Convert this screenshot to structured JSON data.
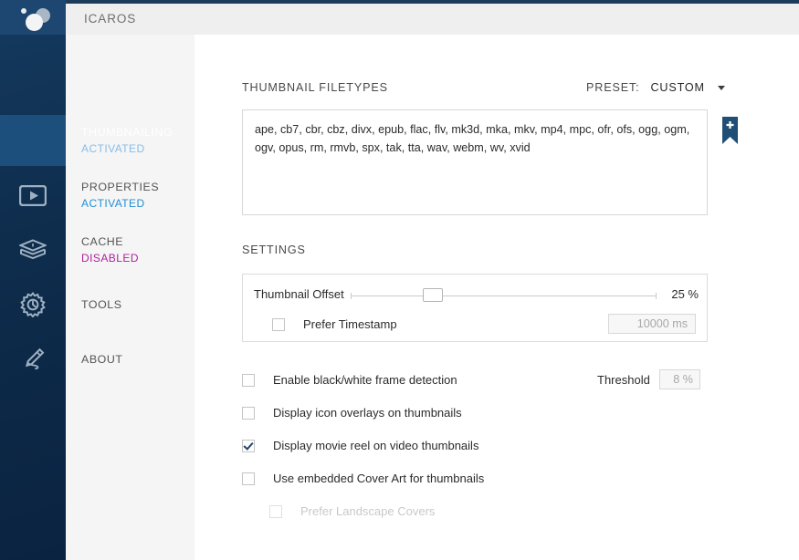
{
  "window": {
    "title": "ICAROS",
    "accent_navy": "#1d3c5c",
    "accent_selected": "#1c4f7c",
    "accent_activated": "#1f8fd6",
    "accent_disabled": "#b0219b"
  },
  "rail": {
    "logo_name": "icaros-logo",
    "icons": [
      {
        "name": "image-icon",
        "for": "thumbnailing"
      },
      {
        "name": "video-play-icon",
        "for": "properties"
      },
      {
        "name": "database-stack-icon",
        "for": "cache"
      },
      {
        "name": "gear-clock-icon",
        "for": "tools"
      },
      {
        "name": "pen-signature-icon",
        "for": "about"
      }
    ]
  },
  "nav": {
    "items": [
      {
        "label": "THUMBNAILING",
        "status": "ACTIVATED",
        "status_kind": "activated",
        "selected": true
      },
      {
        "label": "PROPERTIES",
        "status": "ACTIVATED",
        "status_kind": "activated",
        "selected": false
      },
      {
        "label": "CACHE",
        "status": "DISABLED",
        "status_kind": "disabled",
        "selected": false
      },
      {
        "label": "TOOLS",
        "status": "",
        "status_kind": "none",
        "selected": false
      },
      {
        "label": "ABOUT",
        "status": "",
        "status_kind": "none",
        "selected": false
      }
    ]
  },
  "main": {
    "filetypes_heading": "THUMBNAIL FILETYPES",
    "preset_label": "PRESET:",
    "preset_value": "CUSTOM",
    "filetypes_value": "ape, cb7, cbr, cbz, divx, epub, flac, flv, mk3d, mka, mkv, mp4, mpc, ofr, ofs, ogg, ogm, ogv, opus, rm, rmvb, spx, tak, tta, wav, webm, wv, xvid",
    "add_preset_icon": "bookmark-plus-icon",
    "settings_heading": "SETTINGS",
    "offset_label": "Thumbnail Offset",
    "offset_value": "25 %",
    "offset_percent": 25,
    "prefer_timestamp_label": "Prefer Timestamp",
    "prefer_timestamp_checked": false,
    "timestamp_value": "10000 ms",
    "threshold_label": "Threshold",
    "threshold_value": "8 %",
    "options": [
      {
        "label": "Enable black/white frame detection",
        "checked": false,
        "disabled": false,
        "indent": false
      },
      {
        "label": "Display icon overlays on thumbnails",
        "checked": false,
        "disabled": false,
        "indent": false
      },
      {
        "label": "Display movie reel on video thumbnails",
        "checked": true,
        "disabled": false,
        "indent": false
      },
      {
        "label": "Use embedded Cover Art for thumbnails",
        "checked": false,
        "disabled": false,
        "indent": false
      },
      {
        "label": "Prefer Landscape Covers",
        "checked": false,
        "disabled": true,
        "indent": true
      }
    ]
  }
}
